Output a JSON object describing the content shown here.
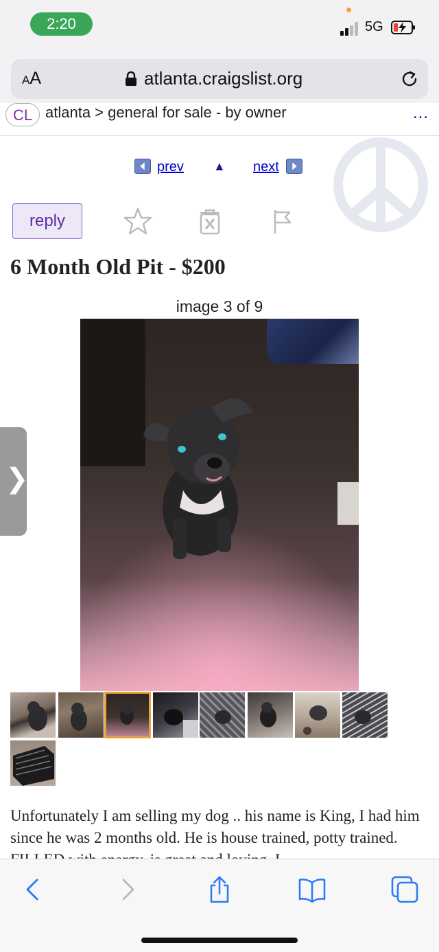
{
  "status_bar": {
    "time": "2:20",
    "network": "5G"
  },
  "browser": {
    "text_size_label": "AA",
    "url": "atlanta.craigslist.org"
  },
  "breadcrumb": {
    "logo": "CL",
    "path": "atlanta > general for sale - by owner",
    "more": "..."
  },
  "pager": {
    "prev": "prev",
    "up": "▲",
    "next": "next"
  },
  "actions": {
    "reply": "reply"
  },
  "posting": {
    "title": "6 Month Old Pit - $200",
    "image_counter": "image 3 of 9",
    "description": "Unfortunately I am selling my dog .. his name is King, I had him since he was 2 months old. He is house trained, potty trained. FILLED with energy, is great and loving. I"
  },
  "thumbnails": [
    {
      "id": "thumb-1",
      "selected": false
    },
    {
      "id": "thumb-2",
      "selected": false
    },
    {
      "id": "thumb-3",
      "selected": true
    },
    {
      "id": "thumb-4",
      "selected": false
    },
    {
      "id": "thumb-5",
      "selected": false
    },
    {
      "id": "thumb-6",
      "selected": false
    },
    {
      "id": "thumb-7",
      "selected": false
    },
    {
      "id": "thumb-8",
      "selected": false
    },
    {
      "id": "thumb-9",
      "selected": false
    }
  ],
  "colors": {
    "link": "#0000cc",
    "reply_text": "#5c2ca8",
    "reply_bg": "#ede8f7",
    "time_pill": "#3aa757",
    "ios_blue": "#2f7bf5"
  },
  "icons": {
    "favorite": "star-icon",
    "hide": "trash-x-icon",
    "flag": "flag-icon",
    "back": "chevron-left-icon",
    "forward": "chevron-right-icon",
    "share": "share-icon",
    "bookmarks": "book-icon",
    "tabs": "tabs-icon"
  }
}
